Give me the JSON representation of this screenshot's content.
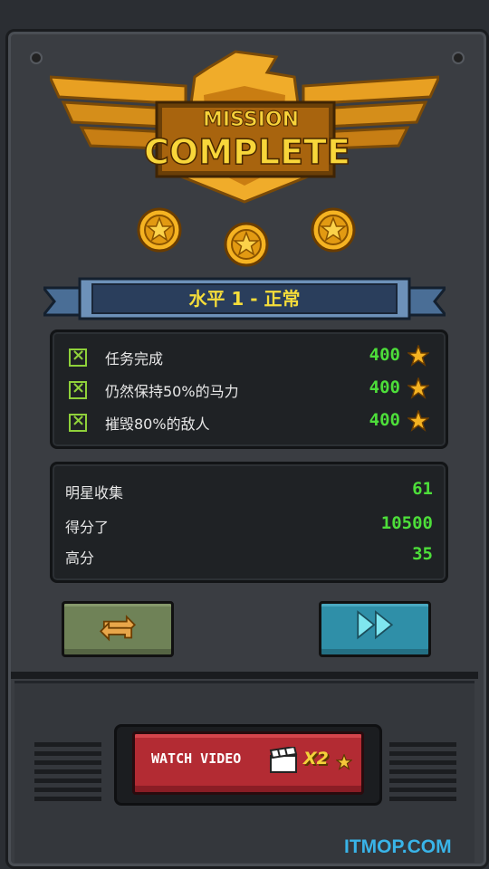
{
  "header": {
    "line1": "MISSION",
    "line2": "COMPLETE",
    "stars_earned": 3,
    "stars_total": 3
  },
  "level_title": "水平 1 - 正常",
  "objectives": [
    {
      "label": "任务完成",
      "points": "400"
    },
    {
      "label": "仍然保持50%的马力",
      "points": "400"
    },
    {
      "label": "摧毁80%的敌人",
      "points": "400"
    }
  ],
  "stats": [
    {
      "label": "明星收集",
      "value": "61"
    },
    {
      "label": "得分了",
      "value": "10500"
    },
    {
      "label": "高分",
      "value": "35"
    }
  ],
  "buttons": {
    "retry_icon": "swap-arrows-icon",
    "next_icon": "fast-forward-icon",
    "watch_video_label": "WATCH VIDEO",
    "watch_video_multiplier": "X2"
  },
  "watermark": "ITMOP.COM",
  "colors": {
    "gold": "#f5b322",
    "points_green": "#4dde3a",
    "title_yellow": "#f5dd3a",
    "retry_green": "#6f8257",
    "next_blue": "#2f8fa8",
    "watch_red": "#b32b33",
    "watermark_blue": "#39b4e8"
  }
}
